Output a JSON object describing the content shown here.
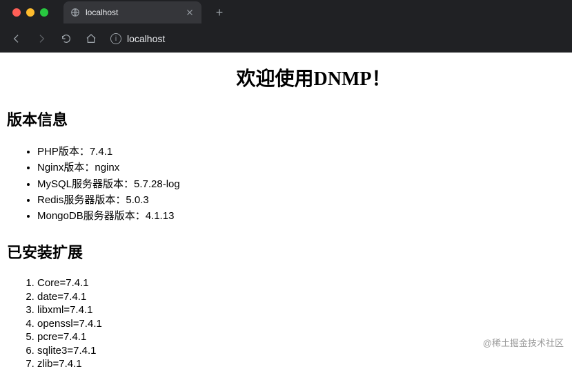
{
  "browser": {
    "tab_title": "localhost",
    "url_display": "localhost",
    "new_tab": "+"
  },
  "page": {
    "title": "欢迎使用DNMP！",
    "versions_heading": "版本信息",
    "versions": [
      "PHP版本：7.4.1",
      "Nginx版本：nginx",
      "MySQL服务器版本：5.7.28-log",
      "Redis服务器版本：5.0.3",
      "MongoDB服务器版本：4.1.13"
    ],
    "extensions_heading": "已安装扩展",
    "extensions": [
      "Core=7.4.1",
      "date=7.4.1",
      "libxml=7.4.1",
      "openssl=7.4.1",
      "pcre=7.4.1",
      "sqlite3=7.4.1",
      "zlib=7.4.1"
    ]
  },
  "watermark": "@稀土掘金技术社区"
}
